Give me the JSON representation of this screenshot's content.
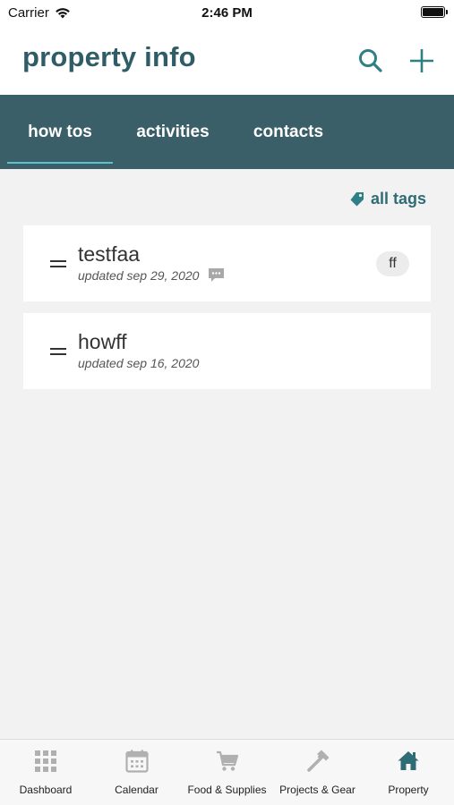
{
  "status_bar": {
    "carrier": "Carrier",
    "time": "2:46 PM"
  },
  "header": {
    "title": "property info",
    "search_icon": "search-icon",
    "add_icon": "plus-icon"
  },
  "tabs": [
    {
      "label": "how tos",
      "active": true
    },
    {
      "label": "activities",
      "active": false
    },
    {
      "label": "contacts",
      "active": false
    }
  ],
  "filter": {
    "label": "all tags",
    "icon": "tag-icon"
  },
  "items": [
    {
      "name": "testfaa",
      "updated": "updated sep 29, 2020",
      "has_comments": true,
      "tag": "ff"
    },
    {
      "name": "howff",
      "updated": "updated sep 16, 2020",
      "has_comments": false,
      "tag": ""
    }
  ],
  "bottom_nav": [
    {
      "label": "Dashboard",
      "icon": "grid-icon",
      "active": false
    },
    {
      "label": "Calendar",
      "icon": "calendar-icon",
      "active": false
    },
    {
      "label": "Food & Supplies",
      "icon": "cart-icon",
      "active": false
    },
    {
      "label": "Projects & Gear",
      "icon": "hammer-icon",
      "active": false
    },
    {
      "label": "Property",
      "icon": "home-icon",
      "active": true
    }
  ],
  "colors": {
    "brand": "#2f5d67",
    "tab_bar": "#3a5f69",
    "tab_indicator": "#5cc2c9",
    "accent": "#2f7f86",
    "inactive_icon": "#b0b0b0"
  }
}
